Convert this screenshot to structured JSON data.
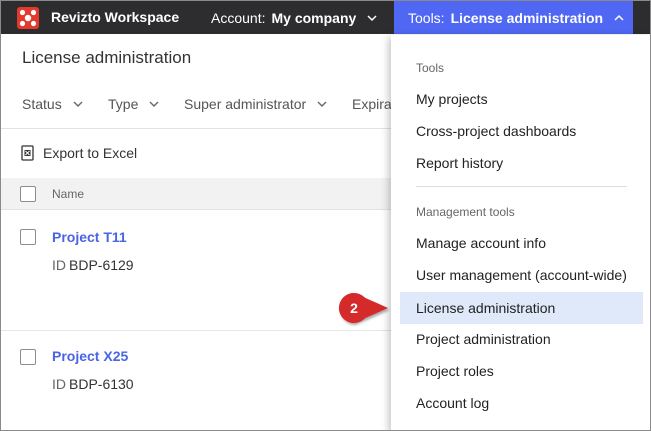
{
  "topbar": {
    "brand": "Revizto Workspace",
    "account_label": "Account:",
    "account_value": "My company",
    "tools_label": "Tools:",
    "tools_value": "License administration",
    "colors": {
      "bar": "#2d2d30",
      "tools_active": "#4f67f2",
      "logo": "#e33a2e"
    }
  },
  "page": {
    "title": "License administration",
    "filters": [
      "Status",
      "Type",
      "Super administrator",
      "Expira"
    ],
    "export_label": "Export to Excel",
    "table_header": {
      "name": "Name"
    },
    "rows": [
      {
        "name": "Project T11",
        "id_prefix": "ID",
        "id": "BDP-6129"
      },
      {
        "name": "Project X25",
        "id_prefix": "ID",
        "id": "BDP-6130"
      }
    ],
    "link_color": "#4a64e6"
  },
  "menu": {
    "section_tools": "Tools",
    "tools_items": [
      "My projects",
      "Cross-project dashboards",
      "Report history"
    ],
    "section_management": "Management tools",
    "management_items": [
      "Manage account info",
      "User management (account-wide)",
      "License administration",
      "Project administration",
      "Project roles",
      "Account log"
    ],
    "active_item": "License administration",
    "active_color": "#dfe9f9"
  },
  "callout": {
    "number": "2",
    "color": "#d42a2a"
  }
}
